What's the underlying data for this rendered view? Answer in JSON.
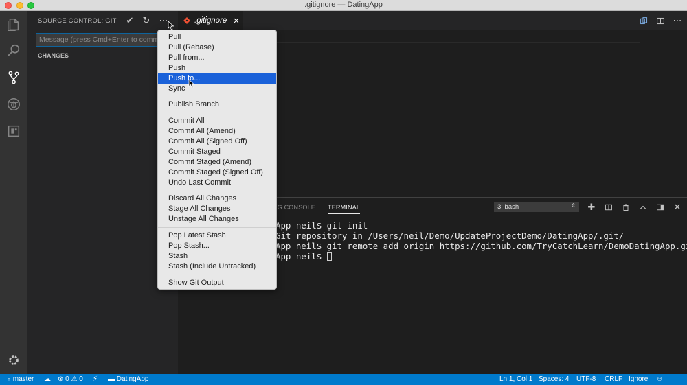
{
  "window": {
    "title": ".gitignore — DatingApp"
  },
  "sidebar": {
    "header": "SOURCE CONTROL: GIT",
    "message_placeholder": "Message (press Cmd+Enter to commit)",
    "changes_label": "CHANGES"
  },
  "editor": {
    "tab_label": ".gitignore",
    "tab_close": "✕"
  },
  "menu": {
    "items": [
      "Pull",
      "Pull (Rebase)",
      "Pull from...",
      "Push",
      "Push to...",
      "Sync",
      "Publish Branch",
      "Commit All",
      "Commit All (Amend)",
      "Commit All (Signed Off)",
      "Commit Staged",
      "Commit Staged (Amend)",
      "Commit Staged (Signed Off)",
      "Undo Last Commit",
      "Discard All Changes",
      "Stage All Changes",
      "Unstage All Changes",
      "Pop Latest Stash",
      "Pop Stash...",
      "Stash",
      "Stash (Include Untracked)",
      "Show Git Output"
    ],
    "selected": "Push to..."
  },
  "panel": {
    "tabs": [
      "UG CONSOLE",
      "TERMINAL"
    ],
    "active_tab": "TERMINAL",
    "terminal_select": "3: bash",
    "lines": [
      "App neil$ git init",
      "Git repository in /Users/neil/Demo/UpdateProjectDemo/DatingApp/.git/",
      "App neil$ git remote add origin https://github.com/TryCatchLearn/DemoDatingApp.git",
      "App neil$ "
    ]
  },
  "status": {
    "branch": "master",
    "errors": "0",
    "warnings": "0",
    "folder": "DatingApp",
    "position": "Ln 1, Col 1",
    "spaces": "Spaces: 4",
    "encoding": "UTF-8",
    "eol": "CRLF",
    "language": "Ignore"
  },
  "colors": {
    "accent": "#007acc",
    "menu_selected": "#1a61d9",
    "git_icon": "#f05033"
  }
}
